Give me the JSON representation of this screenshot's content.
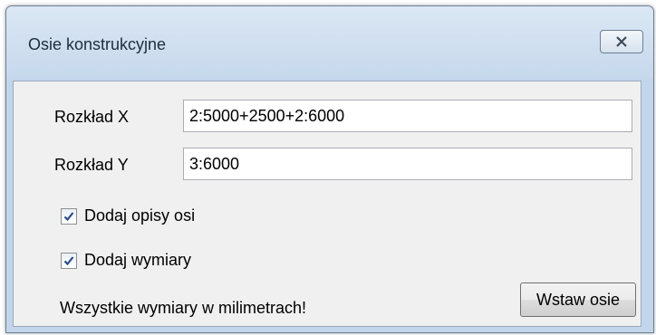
{
  "dialog": {
    "title": "Osie konstrukcyjne",
    "close_icon": "close-icon"
  },
  "fields": {
    "x_label": "Rozkład X",
    "x_value": "2:5000+2500+2:6000",
    "y_label": "Rozkład Y",
    "y_value": "3:6000"
  },
  "options": {
    "add_axis_labels": {
      "label": "Dodaj opisy osi",
      "checked": true
    },
    "add_dimensions": {
      "label": "Dodaj wymiary",
      "checked": true
    }
  },
  "note": "Wszystkie wymiary w milimetrach!",
  "buttons": {
    "insert_label": "Wstaw osie"
  },
  "colors": {
    "frame": "#c3d5ea",
    "client": "#f0f0f0",
    "check_mark": "#2a4a8a"
  }
}
